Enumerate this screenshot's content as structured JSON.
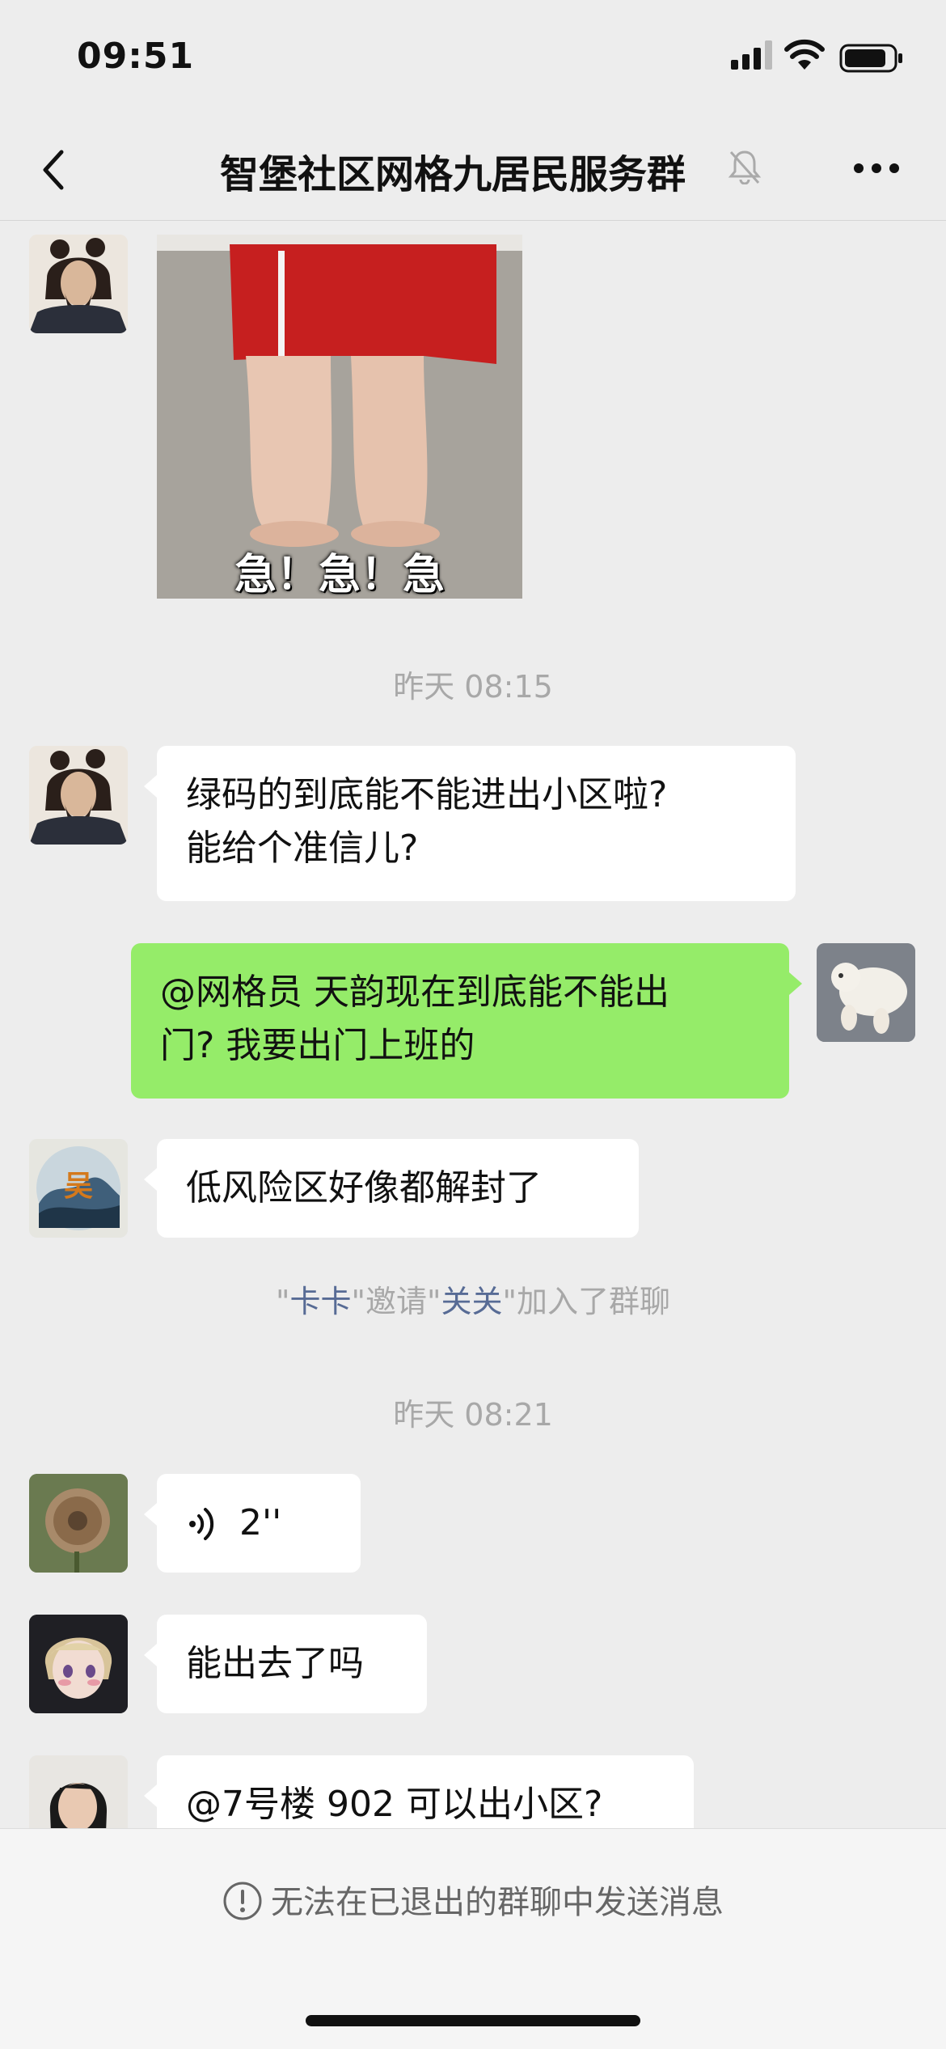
{
  "status_bar": {
    "time": "09:51"
  },
  "header": {
    "title": "智堡社区网格九居民服务群"
  },
  "messages": {
    "sticker_caption": "急！急！急",
    "ts1": "昨天 08:15",
    "msg1_line1": "绿码的到底能不能进出小区啦?",
    "msg1_line2": "能给个准信儿?",
    "msg2_line1": "@网格员 天韵现在到底能不能出",
    "msg2_line2": "门? 我要出门上班的",
    "msg3": "低风险区好像都解封了",
    "system": {
      "q1": "\"",
      "inviter": "卡卡",
      "q2": "\"邀请\"",
      "invitee": "关关",
      "q3": "\"加入了群聊"
    },
    "ts2": "昨天 08:21",
    "voice_duration": "2''",
    "msg5": "能出去了吗",
    "msg6": "@7号楼 902 可以出小区?"
  },
  "footer": {
    "notice": "无法在已退出的群聊中发送消息"
  },
  "colors": {
    "background": "#ededed",
    "outgoing_bubble": "#95ec69",
    "link_name": "#576b95"
  }
}
